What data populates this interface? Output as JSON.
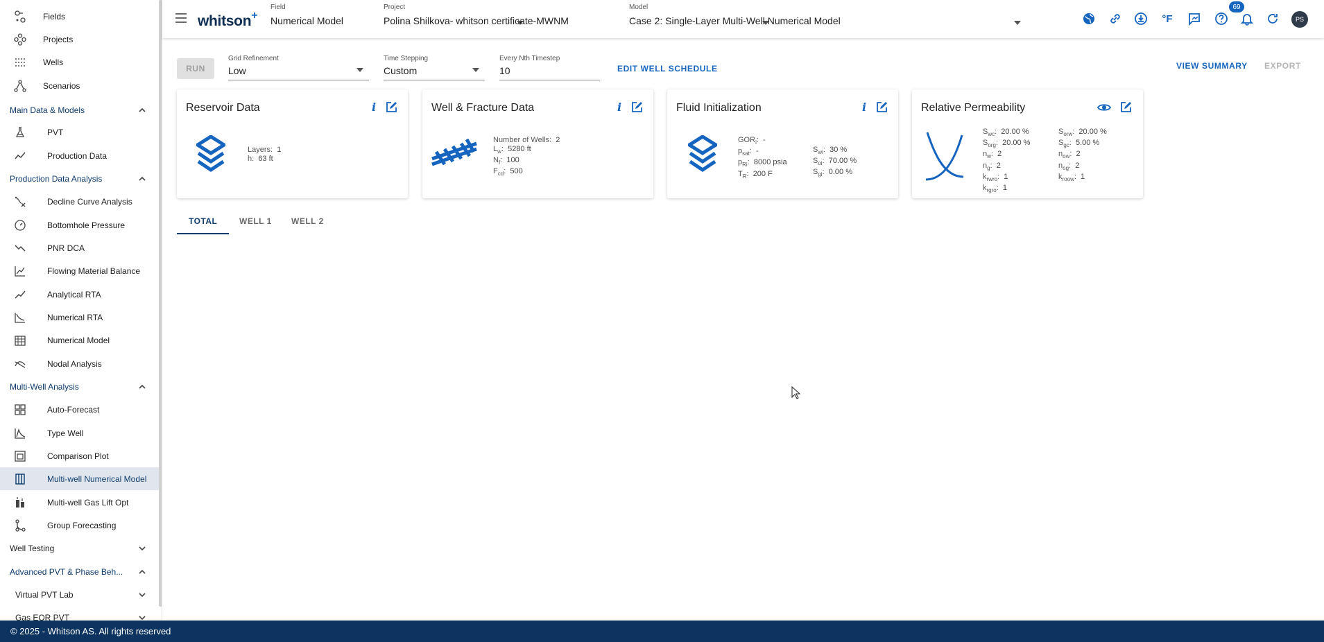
{
  "sidebar": {
    "top_items": [
      {
        "label": "Fields",
        "icon": "fields-icon"
      },
      {
        "label": "Projects",
        "icon": "projects-icon"
      },
      {
        "label": "Wells",
        "icon": "wells-icon"
      },
      {
        "label": "Scenarios",
        "icon": "scenarios-icon"
      }
    ],
    "sections": {
      "main_data": {
        "label": "Main Data & Models",
        "items": [
          {
            "label": "PVT"
          },
          {
            "label": "Production Data"
          }
        ]
      },
      "pda": {
        "label": "Production Data Analysis",
        "items": [
          {
            "label": "Decline Curve Analysis"
          },
          {
            "label": "Bottomhole Pressure"
          },
          {
            "label": "PNR DCA"
          },
          {
            "label": "Flowing Material Balance"
          },
          {
            "label": "Analytical RTA"
          },
          {
            "label": "Numerical RTA"
          },
          {
            "label": "Numerical Model"
          },
          {
            "label": "Nodal Analysis"
          }
        ]
      },
      "mwa": {
        "label": "Multi-Well Analysis",
        "items": [
          {
            "label": "Auto-Forecast"
          },
          {
            "label": "Type Well"
          },
          {
            "label": "Comparison Plot"
          },
          {
            "label": "Multi-well Numerical Model"
          },
          {
            "label": "Multi-well Gas Lift Opt"
          },
          {
            "label": "Group Forecasting"
          }
        ]
      },
      "well_testing": {
        "label": "Well Testing"
      },
      "advanced_pvt": {
        "label": "Advanced PVT & Phase Beh...",
        "items": [
          {
            "label": "Virtual PVT Lab"
          },
          {
            "label": "Gas EOR PVT"
          }
        ]
      }
    },
    "active_item": "Multi-well Numerical Model"
  },
  "topbar": {
    "brand": "whitson",
    "brand_plus": "+",
    "field": {
      "caption": "Field",
      "value": "Numerical Model"
    },
    "project": {
      "caption": "Project",
      "value": "Polina Shilkova- whitson certificate-MWNM"
    },
    "model": {
      "caption": "Model",
      "value": "Case 2: Single-Layer Multi-Well Numerical Model"
    },
    "units_label": "°F",
    "notification_count": "69",
    "avatar_initials": "PS"
  },
  "controls": {
    "run_label": "RUN",
    "grid_refinement": {
      "caption": "Grid Refinement",
      "value": "Low"
    },
    "time_stepping": {
      "caption": "Time Stepping",
      "value": "Custom"
    },
    "nth_timestep": {
      "caption": "Every Nth Timestep",
      "value": "10"
    },
    "edit_schedule_label": "EDIT WELL SCHEDULE",
    "view_summary_label": "VIEW SUMMARY",
    "export_label": "EXPORT"
  },
  "cards": {
    "reservoir": {
      "title": "Reservoir Data",
      "info": "i",
      "layers_label": "Layers:",
      "layers_value": "1",
      "h_label": "h:",
      "h_value": "63 ft"
    },
    "well_fracture": {
      "title": "Well & Fracture Data",
      "info": "i",
      "wells_label": "Number of Wells:",
      "wells_value": "2",
      "lw_label": "L",
      "lw_sub": "w",
      "lw_value": "5280 ft",
      "nf_label": "N",
      "nf_sub": "f",
      "nf_value": "100",
      "fcd_label": "F",
      "fcd_sub": "cd",
      "fcd_value": "500"
    },
    "fluid": {
      "title": "Fluid Initialization",
      "info": "i",
      "gor_label": "GOR",
      "gor_sub": "i",
      "gor_value": "-",
      "psat_label": "p",
      "psat_sub": "sat",
      "psat_value": "-",
      "pri_label": "p",
      "pri_sub": "Ri",
      "pri_value": "8000 psia",
      "tr_label": "T",
      "tr_sub": "R",
      "tr_value": "200 F",
      "swi_label": "S",
      "swi_sub": "wi",
      "swi_value": "30 %",
      "soi_label": "S",
      "soi_sub": "oi",
      "soi_value": "70.00 %",
      "sgi_label": "S",
      "sgi_sub": "gi",
      "sgi_value": "0.00 %"
    },
    "relperm": {
      "title": "Relative Permeability",
      "swc": "20.00 %",
      "sorg": "20.00 %",
      "nw": "2",
      "ng": "2",
      "krwro": "1",
      "krgro": "1",
      "sorw": "20.00 %",
      "sgc": "5.00 %",
      "now": "2",
      "nog": "2",
      "kroow": "1"
    }
  },
  "tabs": [
    "TOTAL",
    "WELL 1",
    "WELL 2"
  ],
  "footer": {
    "text": "© 2025 - Whitson AS. All rights reserved"
  },
  "colors": {
    "accent": "#1565c0",
    "navy": "#0d3461",
    "active_bg": "#e1e6ee"
  }
}
